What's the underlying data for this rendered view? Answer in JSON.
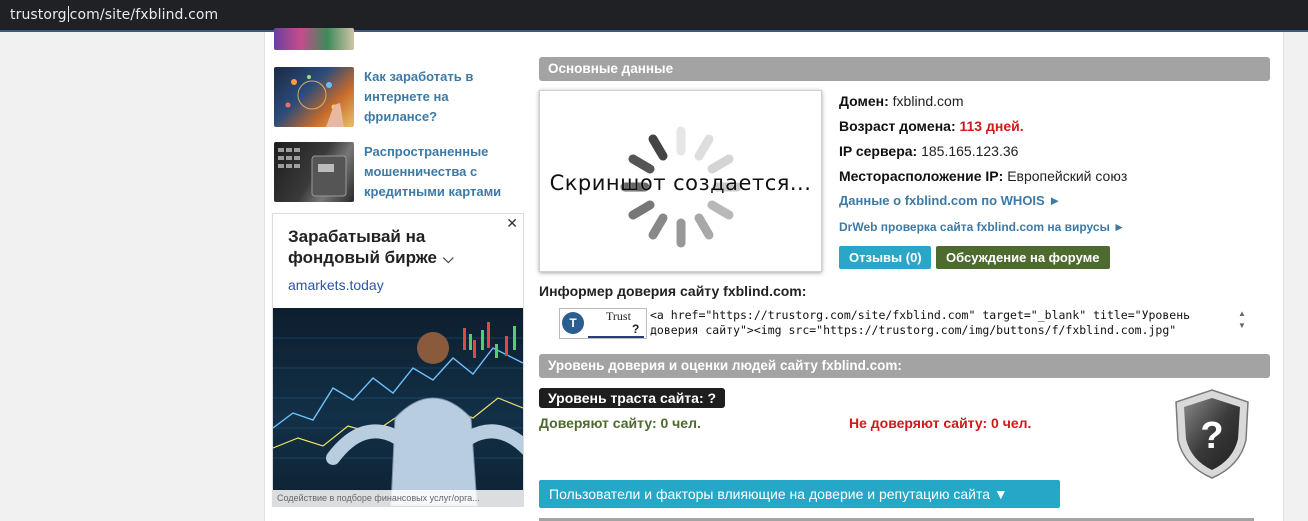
{
  "browser": {
    "url_before_caret": "trustorg",
    "url_after_caret": "com/site/fxblind.com"
  },
  "sidebar": {
    "items": [
      {
        "title": "Как заработать в интернете на фрилансе?"
      },
      {
        "title": "Распространенные мошенничества с кредитными картами"
      }
    ]
  },
  "ad": {
    "close_label": "✕",
    "title": "Зарабатывай на фондовый бирже",
    "chevron": "⌵",
    "domain": "amarkets.today",
    "caption": "Содействие в подборе финансовых услуг/орга..."
  },
  "main": {
    "section_title": "Основные данные",
    "screenshot_text": "Скриншот создается...",
    "domain_label": "Домен:",
    "domain_value": "fxblind.com",
    "age_label": "Возраст домена:",
    "age_value": "113 дней.",
    "ip_label": "IP сервера:",
    "ip_value": "185.165.123.36",
    "location_label": "Месторасположение IP:",
    "location_value": "Европейский союз",
    "whois_link": "Данные о fxblind.com по WHOIS ►",
    "drweb_link": "DrWeb проверка сайта fxblind.com на вирусы ►",
    "reviews_button": "Отзывы (0)",
    "forum_button": "Обсуждение на форуме",
    "informer_label": "Информер доверия сайту fxblind.com:",
    "badge_trust": "Trust",
    "badge_q": "?",
    "code_line1": "<a href=\"https://trustorg.com/site/fxblind.com\" target=\"_blank\" title=\"Уровень",
    "code_line2": "доверия сайту\"><img src=\"https://trustorg.com/img/buttons/f/fxblind.com.jpg\"",
    "trust_section_title": "Уровень доверия и оценки людей сайту fxblind.com:",
    "trust_level": "Уровень траста сайта: ?",
    "trust_yes": "Доверяют сайту: 0 чел.",
    "trust_no": "Не доверяют сайту: 0 чел.",
    "factors_button": "Пользователи и факторы влияющие на доверие и репутацию сайта ▼"
  },
  "colors": {
    "link": "#3d7aa6",
    "section_bar": "#a3a3a3",
    "red": "#d0191b",
    "green": "#4d6b2e",
    "cyan": "#2aa6c7"
  }
}
